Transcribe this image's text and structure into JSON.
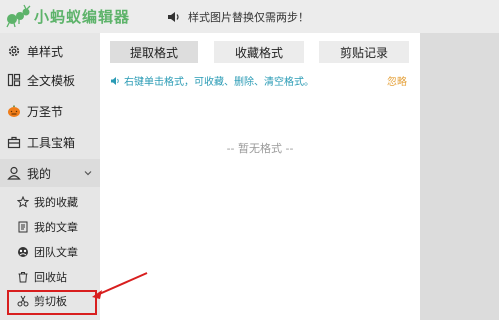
{
  "header": {
    "logo_text": "小蚂蚁编辑器",
    "notice": "样式图片替换仅需两步！"
  },
  "sidebar": {
    "items": [
      {
        "label": "单样式",
        "icon": "gear-icon"
      },
      {
        "label": "全文模板",
        "icon": "template-icon"
      },
      {
        "label": "万圣节",
        "icon": "pumpkin-icon"
      },
      {
        "label": "工具宝箱",
        "icon": "toolbox-icon"
      },
      {
        "label": "我的",
        "icon": "user-icon"
      }
    ],
    "sub_items": [
      {
        "label": "我的收藏",
        "icon": "star-icon"
      },
      {
        "label": "我的文章",
        "icon": "document-icon"
      },
      {
        "label": "团队文章",
        "icon": "team-icon"
      },
      {
        "label": "回收站",
        "icon": "trash-icon"
      },
      {
        "label": "剪切板",
        "icon": "scissors-icon"
      }
    ]
  },
  "panel": {
    "tabs": [
      "提取格式",
      "收藏格式",
      "剪贴记录"
    ],
    "active_tab": "提取格式",
    "hint": "右键单击格式，可收藏、删除、清空格式。",
    "ignore_label": "忽略",
    "empty_text": "-- 暂无格式 --"
  },
  "colors": {
    "logo_green": "#5db36a",
    "hint_blue": "#2a9bb5",
    "ignore_orange": "#e5a13a",
    "annotation_red": "#d81e1e"
  }
}
